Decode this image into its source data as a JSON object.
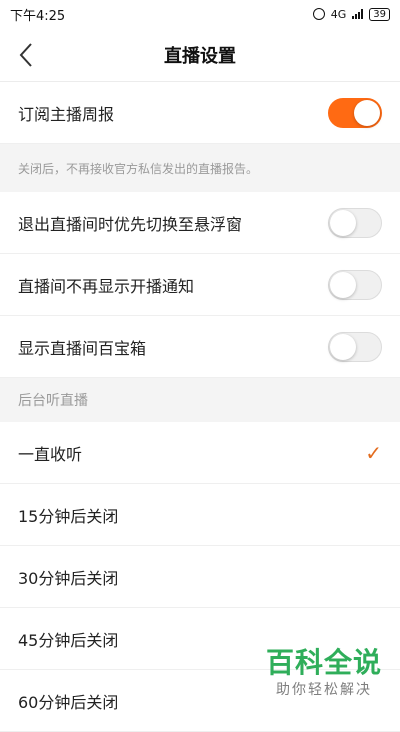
{
  "status_bar": {
    "time": "下午4:25",
    "network": "4G",
    "battery": "39"
  },
  "header": {
    "title": "直播设置"
  },
  "subscribe": {
    "label": "订阅主播周报",
    "enabled": true,
    "note": "关闭后，不再接收官方私信发出的直播报告。"
  },
  "settings": [
    {
      "label": "退出直播间时优先切换至悬浮窗",
      "enabled": false
    },
    {
      "label": "直播间不再显示开播通知",
      "enabled": false
    },
    {
      "label": "显示直播间百宝箱",
      "enabled": false
    }
  ],
  "background_listen": {
    "section_title": "后台听直播",
    "options": [
      {
        "label": "一直收听",
        "selected": true
      },
      {
        "label": "15分钟后关闭",
        "selected": false
      },
      {
        "label": "30分钟后关闭",
        "selected": false
      },
      {
        "label": "45分钟后关闭",
        "selected": false
      },
      {
        "label": "60分钟后关闭",
        "selected": false
      }
    ]
  },
  "watermark": {
    "title": "百科全说",
    "subtitle": "助你轻松解决"
  },
  "colors": {
    "accent": "#ff6a13",
    "check": "#e36c1e",
    "watermark": "#2fae5a"
  }
}
